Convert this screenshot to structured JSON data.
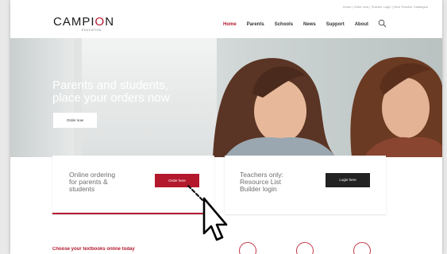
{
  "utility_bar": {
    "text": "Home | Order now | Teacher Login | View Teacher Catalogue"
  },
  "header": {
    "logo": {
      "brand": "CAMPION",
      "tagline": "EDUCATION",
      "accent_color": "#b3182d"
    },
    "nav": [
      {
        "label": "Home",
        "active": true
      },
      {
        "label": "Parents",
        "active": false
      },
      {
        "label": "Schools",
        "active": false
      },
      {
        "label": "News",
        "active": false
      },
      {
        "label": "Support",
        "active": false
      },
      {
        "label": "About",
        "active": false
      }
    ],
    "search_icon": "search-icon"
  },
  "hero": {
    "title_line1": "Parents and students,",
    "title_line2": "place your orders now",
    "button_label": "Order now"
  },
  "cards": {
    "parents": {
      "text_line1": "Online ordering",
      "text_line2": "for parents &",
      "text_line3": "students",
      "button_label": "Order here",
      "button_color": "#b3182d"
    },
    "teachers": {
      "text_line1": "Teachers only:",
      "text_line2": "Resource List",
      "text_line3": "Builder login",
      "button_label": "Login here",
      "button_color": "#222222"
    }
  },
  "section": {
    "heading": "Choose your textbooks online today"
  },
  "pointer": {
    "icon": "hand-pointer-icon"
  }
}
